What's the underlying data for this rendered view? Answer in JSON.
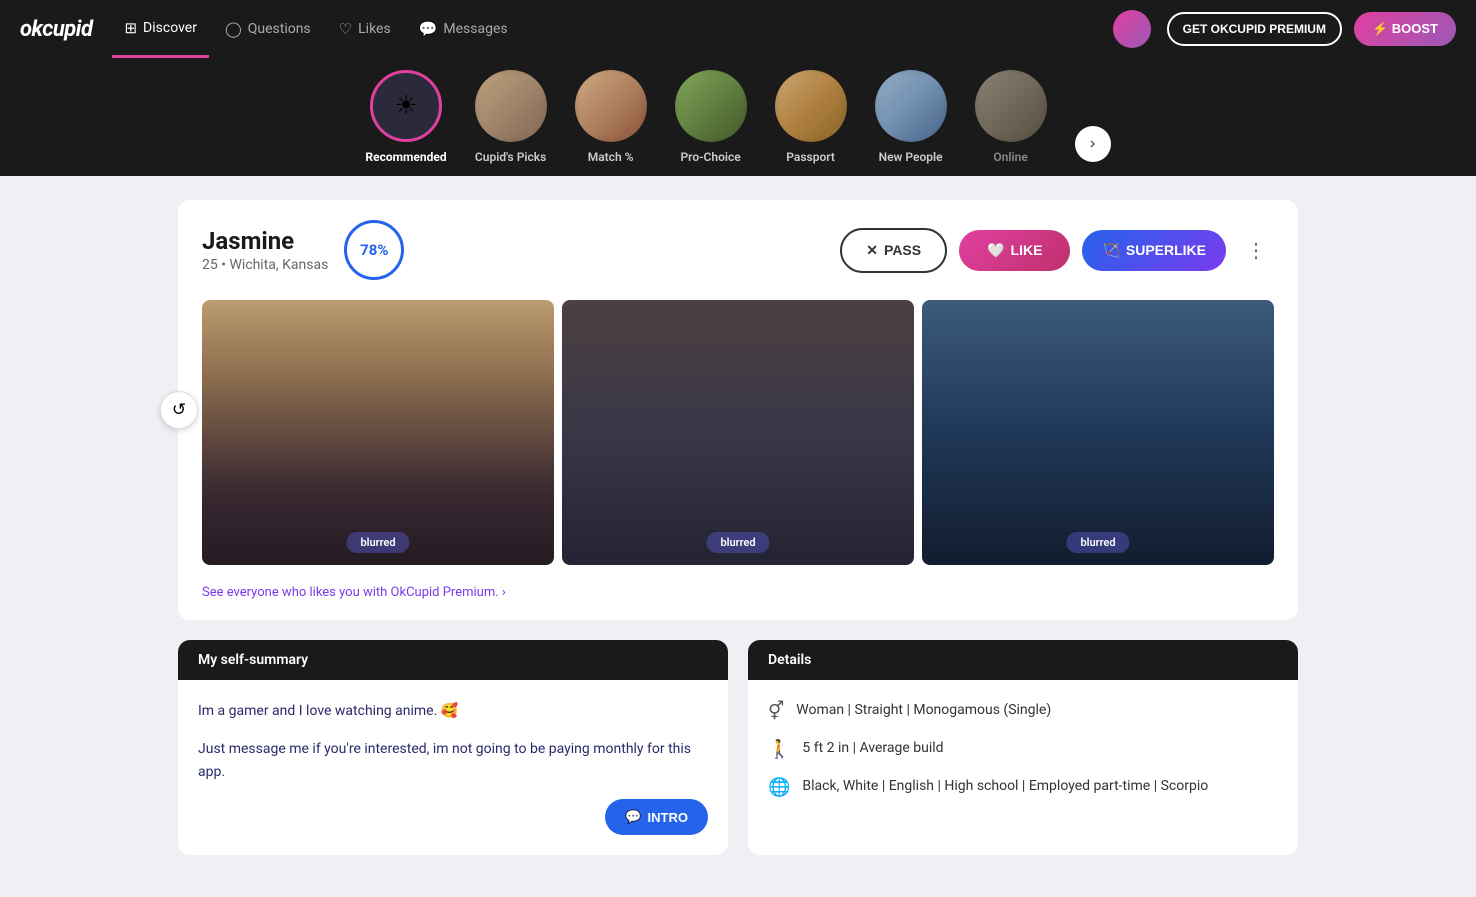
{
  "app": {
    "logo": "okcupid",
    "nav": {
      "items": [
        {
          "id": "discover",
          "label": "Discover",
          "icon": "⊞",
          "active": true
        },
        {
          "id": "questions",
          "label": "Questions",
          "icon": "◯"
        },
        {
          "id": "likes",
          "label": "Likes",
          "icon": "♡"
        },
        {
          "id": "messages",
          "label": "Messages",
          "icon": "□"
        }
      ]
    },
    "premium_btn": "GET OKCUPID PREMIUM",
    "boost_btn": "⚡ BOOST"
  },
  "categories": [
    {
      "id": "recommended",
      "label": "Recommended",
      "active": true,
      "type": "icon"
    },
    {
      "id": "cupids-picks",
      "label": "Cupid's Picks",
      "active": false
    },
    {
      "id": "match",
      "label": "Match %",
      "active": false
    },
    {
      "id": "pro-choice",
      "label": "Pro-Choice",
      "active": false
    },
    {
      "id": "passport",
      "label": "Passport",
      "active": false
    },
    {
      "id": "new-people",
      "label": "New People",
      "active": false
    },
    {
      "id": "online",
      "label": "Online",
      "active": false,
      "dim": true
    }
  ],
  "profile": {
    "name": "Jasmine",
    "age": "25",
    "location": "Wichita, Kansas",
    "match_percent": "78%",
    "actions": {
      "pass": "PASS",
      "like": "LIKE",
      "superlike": "SUPERLIKE"
    },
    "photos": [
      {
        "id": "photo-1",
        "overlay": "blurred"
      },
      {
        "id": "photo-2",
        "overlay": "blurred"
      },
      {
        "id": "photo-3",
        "overlay": "blurred"
      }
    ],
    "premium_link": "See everyone who likes you with OkCupid Premium. ›",
    "self_summary": {
      "header": "My self-summary",
      "text1": "Im a gamer and I love watching anime. 🥰",
      "text2": "Just message me if you're interested, im not going to be paying monthly for this app.",
      "intro_btn": "INTRO"
    },
    "details": {
      "header": "Details",
      "items": [
        {
          "icon": "gender",
          "text": "Woman | Straight | Monogamous (Single)"
        },
        {
          "icon": "height",
          "text": "5 ft 2 in | Average build"
        },
        {
          "icon": "globe",
          "text": "Black, White | English | High school | Employed part-time | Scorpio"
        }
      ]
    }
  }
}
